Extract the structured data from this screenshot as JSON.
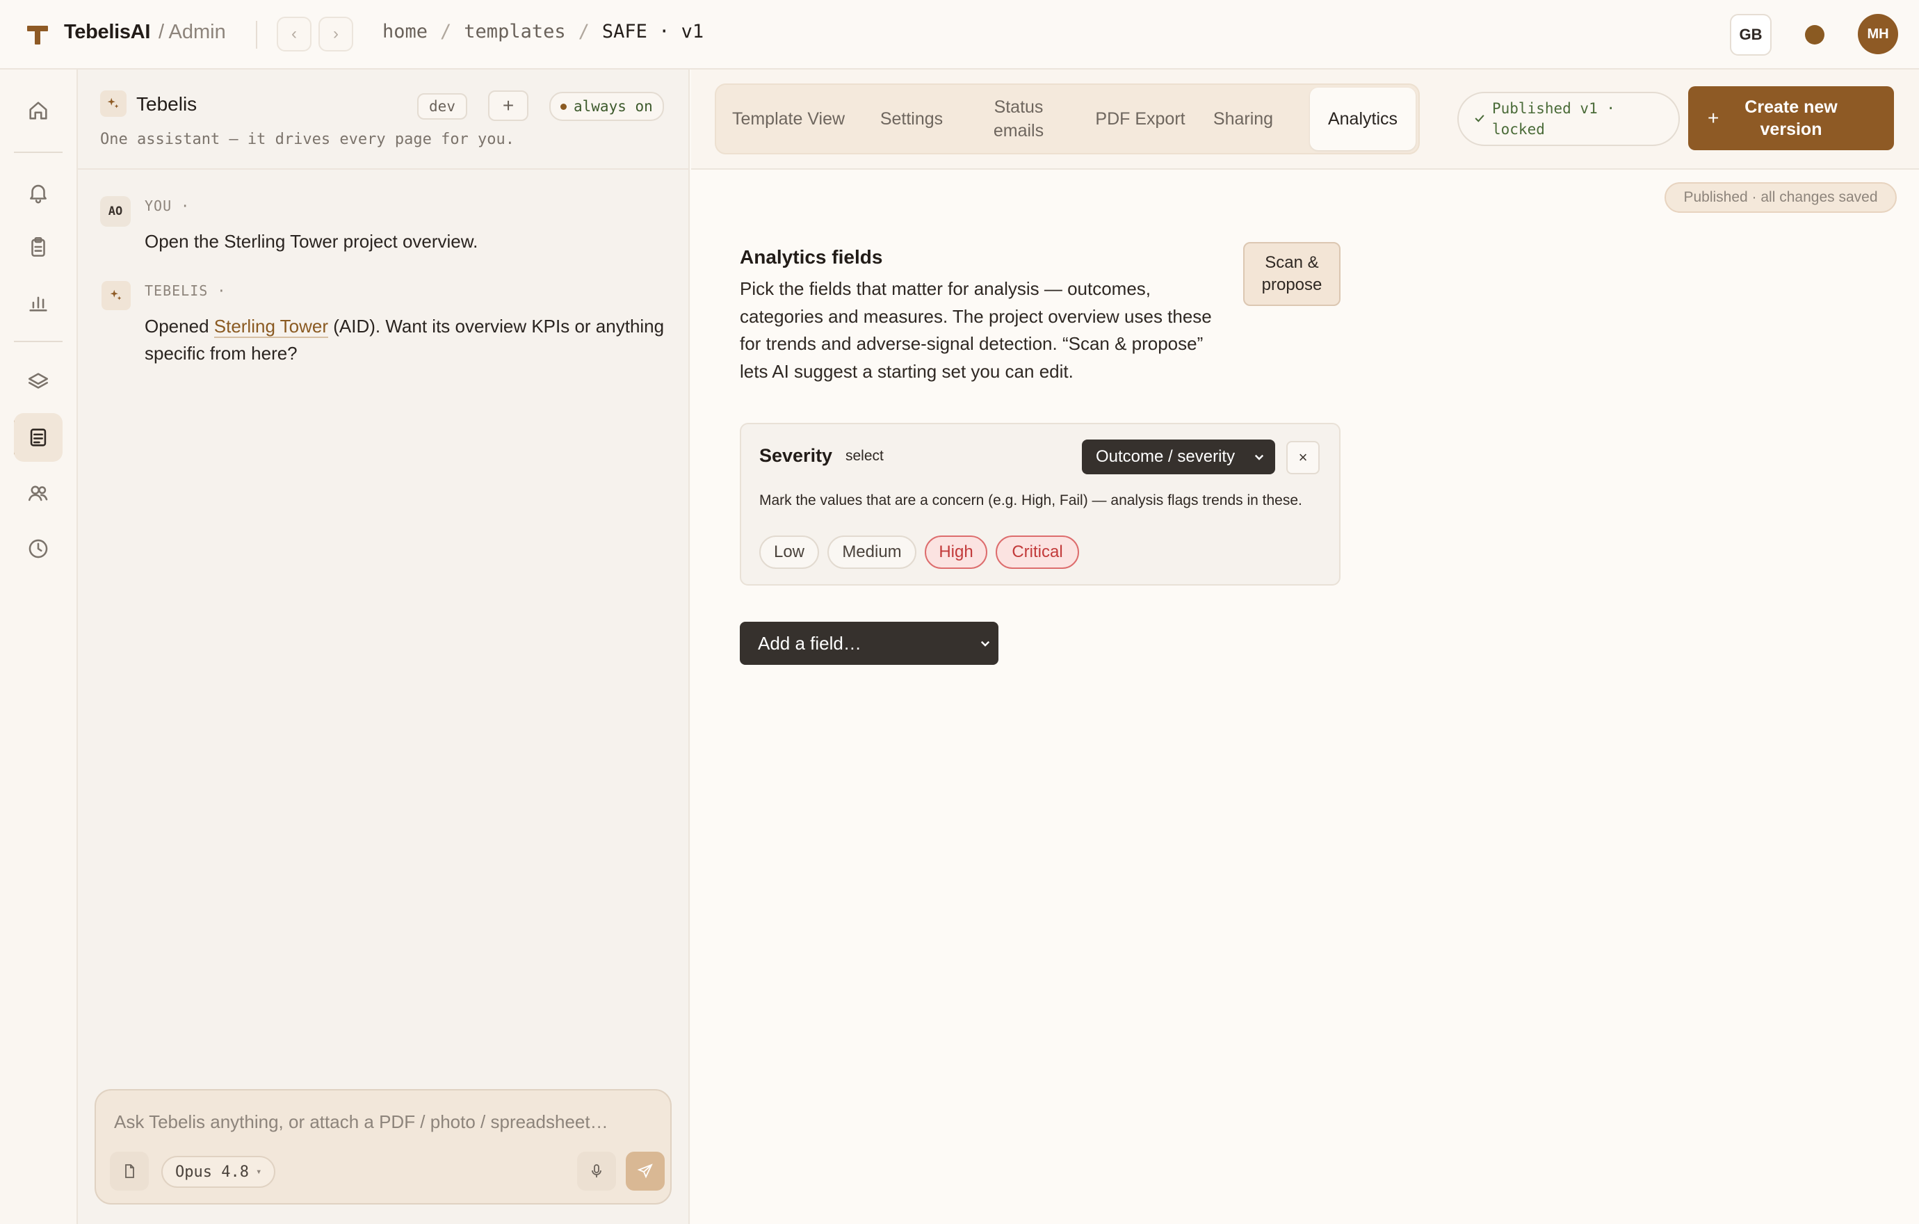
{
  "app": {
    "brand": "TebelisAI",
    "section": "/ Admin"
  },
  "breadcrumb": {
    "home": "home",
    "templates": "templates",
    "current": "SAFE · v1",
    "separator": "/"
  },
  "topbar": {
    "language": "GB",
    "avatar_initials": "MH"
  },
  "rail": {
    "items": [
      "home-icon",
      "bell-icon",
      "clipboard-icon",
      "bar-chart-icon",
      "layers-icon",
      "document-icon",
      "people-icon",
      "clock-icon"
    ],
    "active": "document-icon"
  },
  "chat": {
    "title": "Tebelis",
    "env_chip": "dev",
    "add_chip": "+",
    "status_chip": "always on",
    "subtitle": "One assistant — it drives every page for you.",
    "messages": [
      {
        "avatar": "AO",
        "who": "YOU ·",
        "text": "Open the Sterling Tower project overview."
      },
      {
        "who": "TEBELIS ·",
        "text_before": "Opened ",
        "link": "Sterling Tower",
        "text_after": " (AID). Want its overview KPIs or anything specific from here?"
      }
    ],
    "composer": {
      "placeholder": "Ask Tebelis anything, or attach a PDF / photo / spreadsheet…",
      "model": "Opus 4.8",
      "model_caret": "▾"
    }
  },
  "tabs": [
    {
      "label": "Template View",
      "active": false
    },
    {
      "label": "Settings",
      "active": false
    },
    {
      "label": "Status emails",
      "active": false
    },
    {
      "label": "PDF Export",
      "active": false
    },
    {
      "label": "Sharing",
      "active": false
    },
    {
      "label": "Analytics",
      "active": true
    }
  ],
  "header": {
    "published_status": "Published v1 · locked",
    "create_button": "Create new version",
    "create_plus": "+",
    "saved_status": "Published · all changes saved"
  },
  "analytics": {
    "title": "Analytics fields",
    "description": "Pick the fields that matter for analysis — outcomes, categories and measures. The project overview uses these for trends and adverse-signal detection. “Scan & propose” lets AI suggest a starting set you can edit.",
    "scan_button": "Scan & propose",
    "field": {
      "name": "Severity",
      "type": "select",
      "role": "Outcome / severity",
      "remove": "×",
      "help": "Mark the values that are a concern (e.g. High, Fail) — analysis flags trends in these.",
      "values": [
        {
          "label": "Low",
          "concern": false
        },
        {
          "label": "Medium",
          "concern": false
        },
        {
          "label": "High",
          "concern": true
        },
        {
          "label": "Critical",
          "concern": true
        }
      ]
    },
    "add_field": "Add a field…"
  },
  "colors": {
    "accent": "#8e5a25",
    "concern": "#c23a3a",
    "success": "#4a6b38"
  }
}
